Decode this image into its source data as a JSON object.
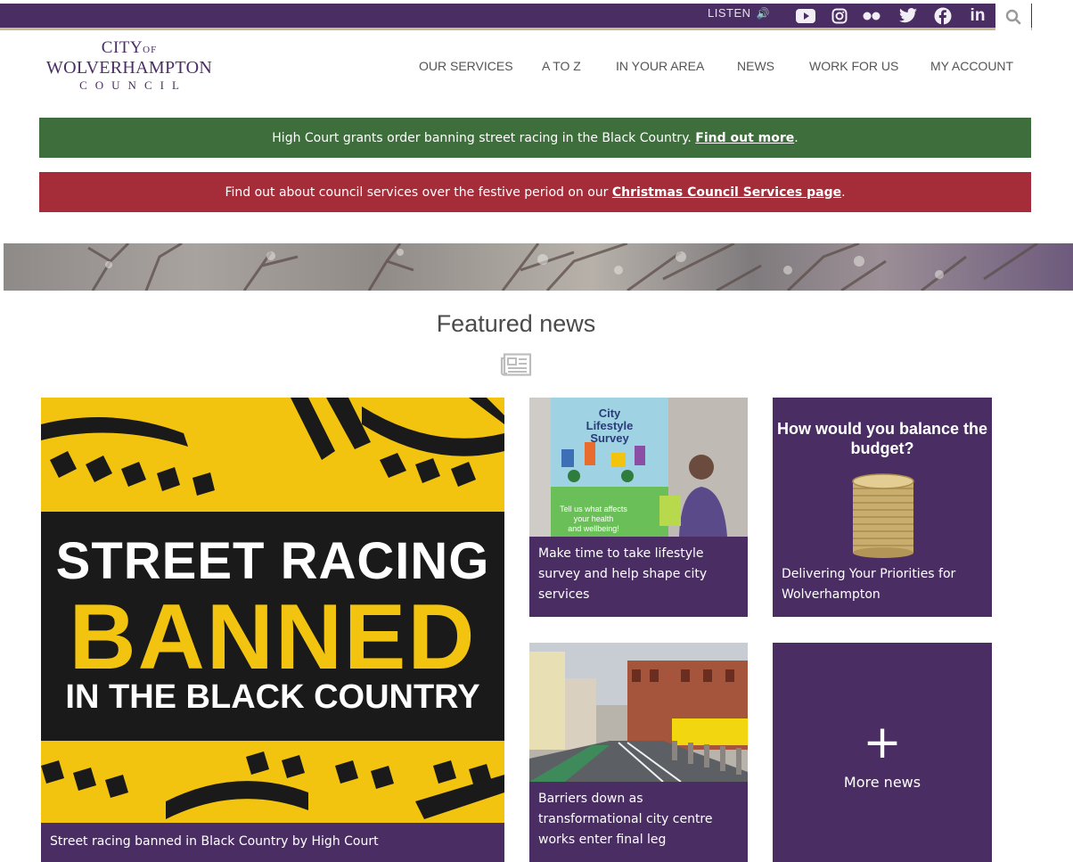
{
  "topbar": {
    "listen_label": "LISTEN",
    "social": [
      {
        "name": "youtube",
        "icon": "youtube-icon"
      },
      {
        "name": "instagram",
        "icon": "instagram-icon"
      },
      {
        "name": "flickr",
        "icon": "flickr-icon"
      },
      {
        "name": "twitter",
        "icon": "twitter-icon"
      },
      {
        "name": "facebook",
        "icon": "facebook-icon"
      },
      {
        "name": "linkedin",
        "icon": "linkedin-icon",
        "text": "in"
      }
    ],
    "search_icon": "search-icon"
  },
  "logo": {
    "line1": "CITY",
    "line1_small": "OF",
    "line2": "WOLVERHAMPTON",
    "line3": "COUNCIL"
  },
  "nav": {
    "items": [
      "OUR SERVICES",
      "A TO Z",
      "IN YOUR AREA",
      "NEWS",
      "WORK FOR US",
      "MY ACCOUNT"
    ]
  },
  "alerts": [
    {
      "text": "High Court grants order banning street racing in the Black Country. ",
      "link": "Find out more",
      "tail": ".",
      "color": "#3f6e3d"
    },
    {
      "text": "Find out about council services over the festive period on our ",
      "link": "Christmas Council Services page",
      "tail": ".",
      "color": "#a52d3a"
    }
  ],
  "featured": {
    "title": "Featured news",
    "cards": [
      {
        "image_text": [
          "STREET RACING",
          "BANNED",
          "IN THE BLACK COUNTRY"
        ],
        "caption": "Street racing banned in Black Country by High Court"
      },
      {
        "image_text": [
          "City",
          "Lifestyle",
          "Survey",
          "Tell us what affects",
          "your health",
          "and wellbeing!"
        ],
        "caption": "Make time to take lifestyle survey and help shape city services"
      },
      {
        "heading": "How would you balance the budget?",
        "caption": "Delivering Your Priorities for Wolverhampton"
      },
      {
        "caption": "Barriers down as transformational city centre works enter final leg"
      },
      {
        "plus": "+",
        "label": "More news"
      }
    ]
  },
  "colors": {
    "brand_purple": "#4a2d63",
    "accent_gold": "#c9b98f",
    "alert_green": "#3f6e3d",
    "alert_red": "#a52d3a",
    "racing_yellow": "#f2c40f"
  }
}
